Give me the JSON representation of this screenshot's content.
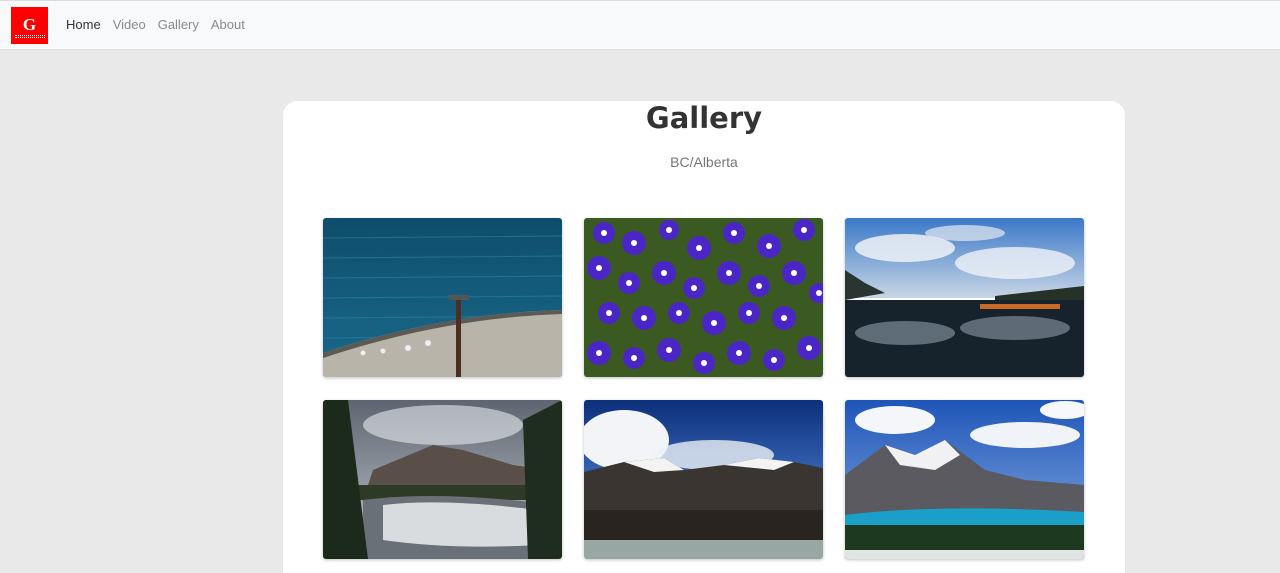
{
  "navbar": {
    "logo_text": "G",
    "links": [
      "Home",
      "Video",
      "Gallery",
      "About"
    ],
    "active": "Home"
  },
  "page": {
    "title": "Gallery",
    "subtitle": "BC/Alberta"
  },
  "gallery": {
    "images": [
      {
        "name": "lake-pier-photo"
      },
      {
        "name": "purple-flowers-photo"
      },
      {
        "name": "lake-reflection-photo"
      },
      {
        "name": "waterfall-photo"
      },
      {
        "name": "snowy-mountains-photo"
      },
      {
        "name": "turquoise-lake-photo"
      }
    ]
  },
  "colors": {
    "brand": "#ff0000",
    "navbar_bg": "#f8f9fa",
    "page_bg": "#e9e9ea"
  }
}
